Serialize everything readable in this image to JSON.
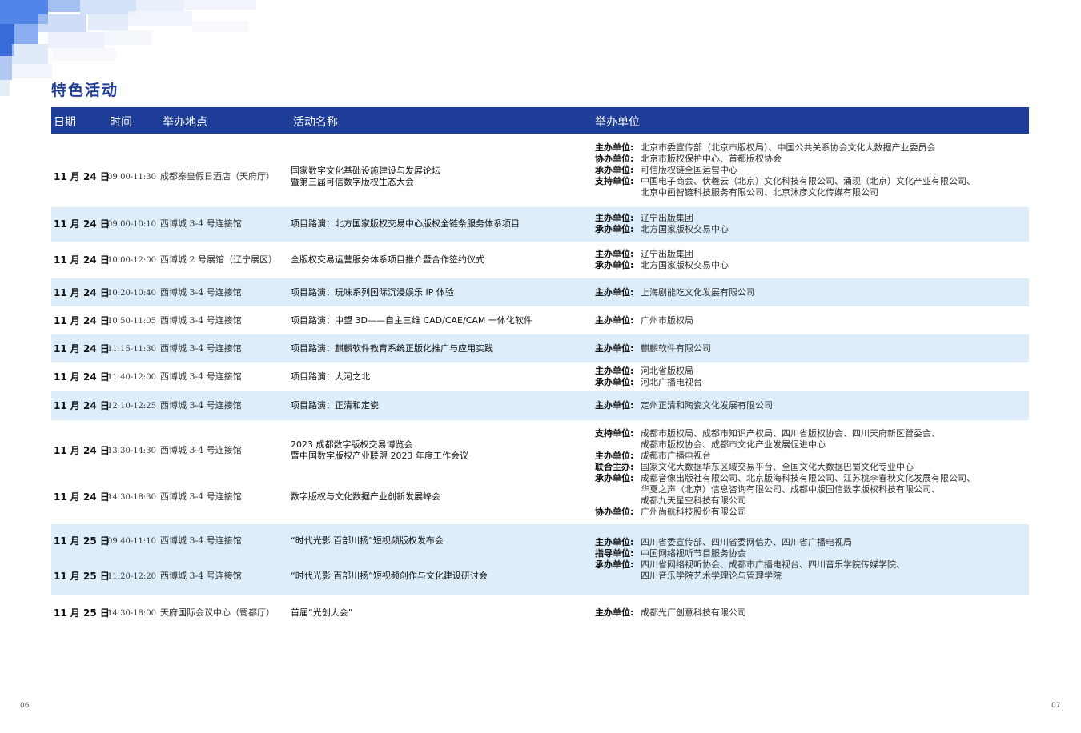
{
  "page_title": "特色活动",
  "headers": [
    "日期",
    "时间",
    "举办地点",
    "活动名称",
    "举办单位"
  ],
  "rows": [
    {
      "date": "11 月 24 日",
      "time": "09:00-11:30",
      "venue": "成都秦皇假日酒店（天府厅）",
      "name_lines": [
        "国家数字文化基础设施建设与发展论坛",
        "暨第三届可信数字版权生态大会"
      ],
      "orgs": [
        {
          "k": "主办单位:",
          "v": "北京市委宣传部（北京市版权局）、中国公共关系协会文化大数据产业委员会"
        },
        {
          "k": "协办单位:",
          "v": "北京市版权保护中心、首都版权协会"
        },
        {
          "k": "承办单位:",
          "v": "可信版权链全国运营中心"
        },
        {
          "k": "支持单位:",
          "v": "中国电子商会、伏羲云（北京）文化科技有限公司、涌现（北京）文化产业有限公司、"
        },
        {
          "k": "",
          "v": "北京中画智链科技服务有限公司、北京沐彦文化传媒有限公司"
        }
      ]
    },
    {
      "date": "11 月 24 日",
      "time": "09:00-10:10",
      "venue": "西博城 3-4 号连接馆",
      "name_lines": [
        "项目路演：北方国家版权交易中心版权全链条服务体系项目"
      ],
      "orgs": [
        {
          "k": "主办单位:",
          "v": "辽宁出版集团"
        },
        {
          "k": "承办单位:",
          "v": "北方国家版权交易中心"
        }
      ]
    },
    {
      "date": "11 月 24 日",
      "time": "10:00-12:00",
      "venue": "西博城 2 号展馆（辽宁展区）",
      "name_lines": [
        "全版权交易运营服务体系项目推介暨合作签约仪式"
      ],
      "orgs": [
        {
          "k": "主办单位:",
          "v": "辽宁出版集团"
        },
        {
          "k": "承办单位:",
          "v": "北方国家版权交易中心"
        }
      ]
    },
    {
      "date": "11 月 24 日",
      "time": "10:20-10:40",
      "venue": "西博城 3-4 号连接馆",
      "name_lines": [
        "项目路演：玩味系列国际沉浸娱乐 IP 体验"
      ],
      "orgs": [
        {
          "k": "主办单位:",
          "v": "上海剧能吃文化发展有限公司"
        }
      ]
    },
    {
      "date": "11 月 24 日",
      "time": "10:50-11:05",
      "venue": "西博城 3-4 号连接馆",
      "name_lines": [
        "项目路演：中望 3D——自主三维 CAD/CAE/CAM 一体化软件"
      ],
      "orgs": [
        {
          "k": "主办单位:",
          "v": "广州市版权局"
        }
      ]
    },
    {
      "date": "11 月 24 日",
      "time": "11:15-11:30",
      "venue": "西博城 3-4 号连接馆",
      "name_lines": [
        "项目路演：麒麟软件教育系统正版化推广与应用实践"
      ],
      "orgs": [
        {
          "k": "主办单位:",
          "v": "麒麟软件有限公司"
        }
      ]
    },
    {
      "date": "11 月 24 日",
      "time": "11:40-12:00",
      "venue": "西博城 3-4 号连接馆",
      "name_lines": [
        "项目路演：大河之北"
      ],
      "orgs": [
        {
          "k": "主办单位:",
          "v": "河北省版权局"
        },
        {
          "k": "承办单位:",
          "v": "河北广播电视台"
        }
      ]
    },
    {
      "date": "11 月 24 日",
      "time": "12:10-12:25",
      "venue": "西博城 3-4 号连接馆",
      "name_lines": [
        "项目路演：正清和定瓷"
      ],
      "orgs": [
        {
          "k": "主办单位:",
          "v": "定州正清和陶瓷文化发展有限公司"
        }
      ]
    },
    {
      "date": "11 月 24 日",
      "time": "13:30-14:30",
      "venue": "西博城 3-4 号连接馆",
      "name_lines": [
        "2023 成都数字版权交易博览会",
        "暨中国数字版权产业联盟 2023 年度工作会议"
      ],
      "orgs": [
        {
          "k": "支持单位:",
          "v": "成都市版权局、成都市知识产权局、四川省版权协会、四川天府新区管委会、"
        },
        {
          "k": "",
          "v": "成都市版权协会、成都市文化产业发展促进中心"
        },
        {
          "k": "主办单位:",
          "v": "成都市广播电视台"
        },
        {
          "k": "联合主办:",
          "v": "国家文化大数据华东区域交易平台、全国文化大数据巴蜀文化专业中心"
        },
        {
          "k": "承办单位:",
          "v": "成都音像出版社有限公司、北京版海科技有限公司、江苏桃李春秋文化发展有限公司、"
        },
        {
          "k": "",
          "v": "华夏之声（北京）信息咨询有限公司、成都中版国信数字版权科技有限公司、"
        },
        {
          "k": "",
          "v": "成都九天星空科技有限公司"
        },
        {
          "k": "协办单位:",
          "v": "广州尚航科技股份有限公司"
        }
      ]
    },
    {
      "date": "11 月 24 日",
      "time": "14:30-18:30",
      "venue": "西博城 3-4 号连接馆",
      "name_lines": [
        "数字版权与文化数据产业创新发展峰会"
      ],
      "orgs": []
    },
    {
      "date": "11 月 25 日",
      "time": "09:40-11:10",
      "venue": "西博城 3-4 号连接馆",
      "name_lines": [
        "“时代光影 百部川扬”短视频版权发布会"
      ],
      "orgs": [
        {
          "k": "主办单位:",
          "v": "四川省委宣传部、四川省委网信办、四川省广播电视局"
        },
        {
          "k": "指导单位:",
          "v": "中国网络视听节目服务协会"
        },
        {
          "k": "承办单位:",
          "v": "四川省网络视听协会、成都市广播电视台、四川音乐学院传媒学院、"
        },
        {
          "k": "",
          "v": "四川音乐学院艺术学理论与管理学院"
        }
      ]
    },
    {
      "date": "11 月 25 日",
      "time": "11:20-12:20",
      "venue": "西博城 3-4 号连接馆",
      "name_lines": [
        "“时代光影 百部川扬”短视频创作与文化建设研讨会"
      ],
      "orgs": []
    },
    {
      "date": "11 月 25 日",
      "time": "14:30-18:00",
      "venue": "天府国际会议中心（蜀都厅）",
      "name_lines": [
        "首届“光创大会”"
      ],
      "orgs": [
        {
          "k": "主办单位:",
          "v": "成都光厂创意科技有限公司"
        }
      ]
    }
  ],
  "page_numbers": {
    "left": "06",
    "right": "07"
  },
  "colors": {
    "header_bg": "#1e3d99",
    "title": "#1f3f9a",
    "row_alt": "#ddedf9"
  }
}
